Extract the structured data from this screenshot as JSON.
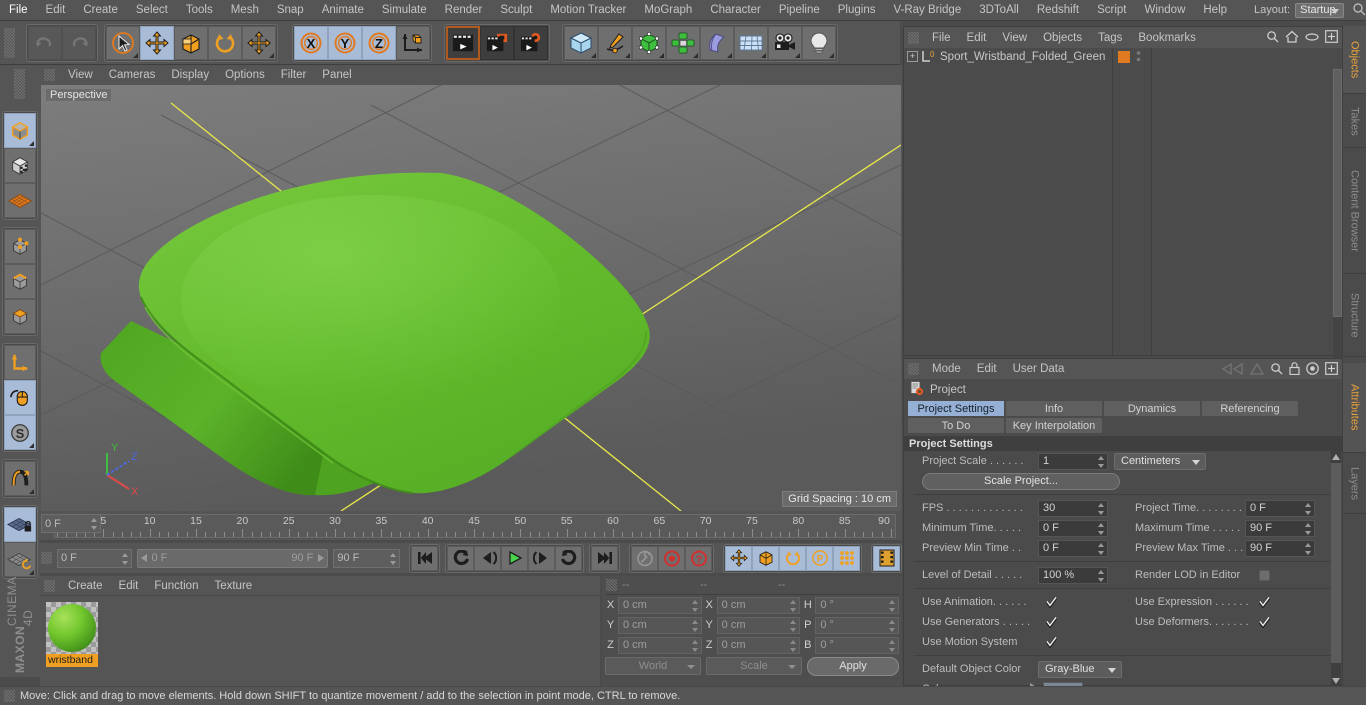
{
  "menubar": {
    "items": [
      "File",
      "Edit",
      "Create",
      "Select",
      "Tools",
      "Mesh",
      "Snap",
      "Animate",
      "Simulate",
      "Render",
      "Sculpt",
      "Motion Tracker",
      "MoGraph",
      "Character",
      "Pipeline",
      "Plugins",
      "V-Ray Bridge",
      "3DToAll",
      "Redshift",
      "Script",
      "Window",
      "Help"
    ],
    "layout_label": "Layout:",
    "layout_value": "Startup",
    "search_icon": "search-icon"
  },
  "toolbar": {
    "groups": [
      {
        "name": "history",
        "buttons": [
          {
            "name": "undo-button",
            "icon": "undo-icon",
            "state": "disabled"
          },
          {
            "name": "redo-button",
            "icon": "redo-icon",
            "state": "disabled"
          }
        ]
      },
      {
        "name": "selection-transform",
        "buttons": [
          {
            "name": "live-selection-button",
            "icon": "cursor-circle-icon",
            "state": "normal"
          },
          {
            "name": "move-button",
            "icon": "move-arrows-icon",
            "state": "selected"
          },
          {
            "name": "scale-button",
            "icon": "scale-box-icon",
            "state": "normal"
          },
          {
            "name": "rotate-button",
            "icon": "rotate-circle-icon",
            "state": "normal"
          },
          {
            "name": "free-move-button",
            "icon": "move-arrows-icon",
            "state": "normal"
          }
        ]
      },
      {
        "name": "axis-locks",
        "buttons": [
          {
            "name": "x-axis-lock-button",
            "icon": "x-axis-icon",
            "state": "selected"
          },
          {
            "name": "y-axis-lock-button",
            "icon": "y-axis-icon",
            "state": "selected"
          },
          {
            "name": "z-axis-lock-button",
            "icon": "z-axis-icon",
            "state": "selected"
          },
          {
            "name": "world-object-coords-button",
            "icon": "world-axis-cube-icon",
            "state": "normal"
          }
        ]
      },
      {
        "name": "render",
        "buttons": [
          {
            "name": "render-view-button",
            "icon": "clapper-frame-icon",
            "state": "dark"
          },
          {
            "name": "render-to-picture-viewer-button",
            "icon": "clapper-picture-icon",
            "state": "dark"
          },
          {
            "name": "render-settings-button",
            "icon": "clapper-gear-icon",
            "state": "dark"
          }
        ]
      },
      {
        "name": "create",
        "buttons": [
          {
            "name": "add-cube-button",
            "icon": "cube-icon",
            "state": "normal"
          },
          {
            "name": "add-spline-button",
            "icon": "pen-spline-icon",
            "state": "normal"
          },
          {
            "name": "add-generator-button",
            "icon": "green-cube-icon",
            "state": "normal"
          },
          {
            "name": "add-mograph-button",
            "icon": "cloner-icon",
            "state": "normal"
          },
          {
            "name": "add-deformer-button",
            "icon": "bend-deformer-icon",
            "state": "normal"
          },
          {
            "name": "add-scene-button",
            "icon": "floor-grid-icon",
            "state": "normal"
          },
          {
            "name": "add-camera-button",
            "icon": "camera-icon",
            "state": "normal"
          },
          {
            "name": "add-light-button",
            "icon": "light-bulb-icon",
            "state": "normal"
          }
        ]
      }
    ]
  },
  "left_toolbar": {
    "groups": [
      {
        "buttons": [
          {
            "name": "model-mode-button",
            "icon": "model-cube-icon",
            "state": "selected"
          },
          {
            "name": "texture-mode-button",
            "icon": "texture-cube-icon",
            "state": "normal"
          },
          {
            "name": "workplane-button",
            "icon": "workplane-grid-icon",
            "state": "normal"
          }
        ]
      },
      {
        "buttons": [
          {
            "name": "points-mode-button",
            "icon": "points-cube-icon",
            "state": "normal"
          },
          {
            "name": "edges-mode-button",
            "icon": "edges-cube-icon",
            "state": "normal"
          },
          {
            "name": "polygons-mode-button",
            "icon": "polygons-cube-icon",
            "state": "normal"
          }
        ]
      },
      {
        "buttons": [
          {
            "name": "object-axis-button",
            "icon": "axis-L-icon",
            "state": "normal"
          },
          {
            "name": "enable-axis-modification-button",
            "icon": "mouse-axis-icon",
            "state": "selected"
          },
          {
            "name": "soft-selection-button",
            "icon": "soft-selection-s-icon",
            "state": "selected"
          }
        ]
      },
      {
        "buttons": [
          {
            "name": "snap-magnet-button",
            "icon": "magnet-icon",
            "state": "normal"
          }
        ]
      },
      {
        "buttons": [
          {
            "name": "workplane-lock-button",
            "icon": "workplane-lock-icon",
            "state": "selected"
          },
          {
            "name": "workplane-reset-button",
            "icon": "workplane-reset-icon",
            "state": "normal"
          }
        ]
      }
    ],
    "brand_line1": "MAXON",
    "brand_line2": "CINEMA 4D"
  },
  "viewport": {
    "menu": [
      "View",
      "Cameras",
      "Display",
      "Options",
      "Filter",
      "Panel"
    ],
    "perspective_label": "Perspective",
    "grid_spacing_label": "Grid Spacing : 10 cm",
    "axis_gizmo": {
      "x": "X",
      "y": "Y",
      "z": "Z",
      "x_color": "#e04a4a",
      "y_color": "#3fbf3f",
      "z_color": "#4a6ae0"
    },
    "object_color": "#5fbb2a"
  },
  "timeline": {
    "ticks": [
      0,
      5,
      10,
      15,
      20,
      25,
      30,
      35,
      40,
      45,
      50,
      55,
      60,
      65,
      70,
      75,
      80,
      85,
      90
    ],
    "min": 0,
    "max": 90,
    "current_frame_field": "0 F"
  },
  "transport": {
    "current_frame": "0 F",
    "range_start": "0 F",
    "range_end": "90 F",
    "end_frame": "90 F",
    "buttons": [
      {
        "name": "go-to-start-button",
        "icon": "skip-start-icon"
      },
      {
        "name": "previous-key-button",
        "icon": "previous-key-icon"
      },
      {
        "name": "step-back-button",
        "icon": "step-back-icon"
      },
      {
        "name": "play-button",
        "icon": "play-icon"
      },
      {
        "name": "step-forward-button",
        "icon": "step-forward-icon"
      },
      {
        "name": "next-key-button",
        "icon": "next-key-icon"
      },
      {
        "name": "go-to-end-button",
        "icon": "skip-end-icon"
      },
      {
        "name": "record-settings-button",
        "icon": "wrench-icon"
      },
      {
        "name": "record-button",
        "icon": "record-icon"
      },
      {
        "name": "autokey-button",
        "icon": "question-key-icon"
      },
      {
        "name": "record-position-button",
        "icon": "move-arrows-icon"
      },
      {
        "name": "record-scale-button",
        "icon": "scale-box-icon"
      },
      {
        "name": "record-rotation-button",
        "icon": "rotate-circle-icon"
      },
      {
        "name": "record-parameter-button",
        "icon": "parameter-p-icon"
      },
      {
        "name": "record-pla-button",
        "icon": "point-level-anim-icon"
      },
      {
        "name": "timeline-toggle-button",
        "icon": "film-strip-icon"
      }
    ]
  },
  "material_manager": {
    "menu": [
      "Create",
      "Edit",
      "Function",
      "Texture"
    ],
    "materials": [
      {
        "name": "wristband",
        "label": "wristband",
        "color": "#5fbb2a"
      }
    ]
  },
  "coordinates": {
    "headers": [
      "--",
      "--",
      "--"
    ],
    "rows": [
      {
        "label1": "X",
        "value1": "0 cm",
        "label2": "X",
        "value2": "0 cm",
        "label3": "H",
        "value3": "0 °"
      },
      {
        "label1": "Y",
        "value1": "0 cm",
        "label2": "Y",
        "value2": "0 cm",
        "label3": "P",
        "value3": "0 °"
      },
      {
        "label1": "Z",
        "value1": "0 cm",
        "label2": "Z",
        "value2": "0 cm",
        "label3": "B",
        "value3": "0 °"
      }
    ],
    "system": "World",
    "mode": "Scale",
    "apply_label": "Apply"
  },
  "statusbar": {
    "text": "Move: Click and drag to move elements. Hold down SHIFT to quantize movement / add to the selection in point mode, CTRL to remove."
  },
  "object_manager": {
    "menu": [
      "File",
      "Edit",
      "View",
      "Objects",
      "Tags",
      "Bookmarks"
    ],
    "objects": [
      {
        "name": "Sport_Wristband_Folded_Green",
        "tag_color": "#e07a20",
        "level_badge": "0"
      }
    ]
  },
  "attributes": {
    "menu": [
      "Mode",
      "Edit",
      "User Data"
    ],
    "object_title": "Project",
    "tabs_row1": [
      {
        "label": "Project Settings",
        "active": true
      },
      {
        "label": "Info",
        "active": false
      },
      {
        "label": "Dynamics",
        "active": false
      },
      {
        "label": "Referencing",
        "active": false
      }
    ],
    "tabs_row2": [
      {
        "label": "To Do",
        "active": false
      },
      {
        "label": "Key Interpolation",
        "active": false
      }
    ],
    "section_title": "Project Settings",
    "project_scale_label": "Project Scale . . . . . .",
    "project_scale_value": "1",
    "project_scale_unit": "Centimeters",
    "scale_project_button": "Scale Project...",
    "fields": [
      {
        "label": "FPS . . . . . . . . . . . . .",
        "value": "30",
        "label2": "Project Time. . . . . . . .",
        "value2": "0 F"
      },
      {
        "label": "Minimum Time. . . . .",
        "value": "0 F",
        "label2": "Maximum Time  . . . . .",
        "value2": "90 F"
      },
      {
        "label": "Preview Min Time . .",
        "value": "0 F",
        "label2": "Preview Max Time . . .",
        "value2": "90 F"
      }
    ],
    "lod_label": "Level of Detail . . . . .",
    "lod_value": "100 %",
    "render_lod_label": "Render LOD in Editor",
    "render_lod_checked": false,
    "checkboxes": [
      {
        "label": "Use Animation. . . . . .",
        "checked": true,
        "label2": "Use Expression . . . . . .",
        "checked2": true
      },
      {
        "label": "Use Generators . . . . .",
        "checked": true,
        "label2": "Use Deformers. . . . . . .",
        "checked2": true
      },
      {
        "label": "Use Motion System",
        "checked": true,
        "label2": "",
        "checked2": null
      }
    ],
    "default_object_color_label": "Default Object Color",
    "default_object_color_value": "Gray-Blue",
    "color_label": "Color  . . . . . . . . . .",
    "color_swatch": "#7b8896"
  },
  "vertical_tabs_top": [
    {
      "label": "Objects",
      "active": true
    },
    {
      "label": "Takes",
      "active": false
    },
    {
      "label": "Content Browser",
      "active": false
    },
    {
      "label": "Structure",
      "active": false
    }
  ],
  "vertical_tabs_bottom": [
    {
      "label": "Attributes",
      "active": true
    },
    {
      "label": "Layers",
      "active": false
    }
  ]
}
